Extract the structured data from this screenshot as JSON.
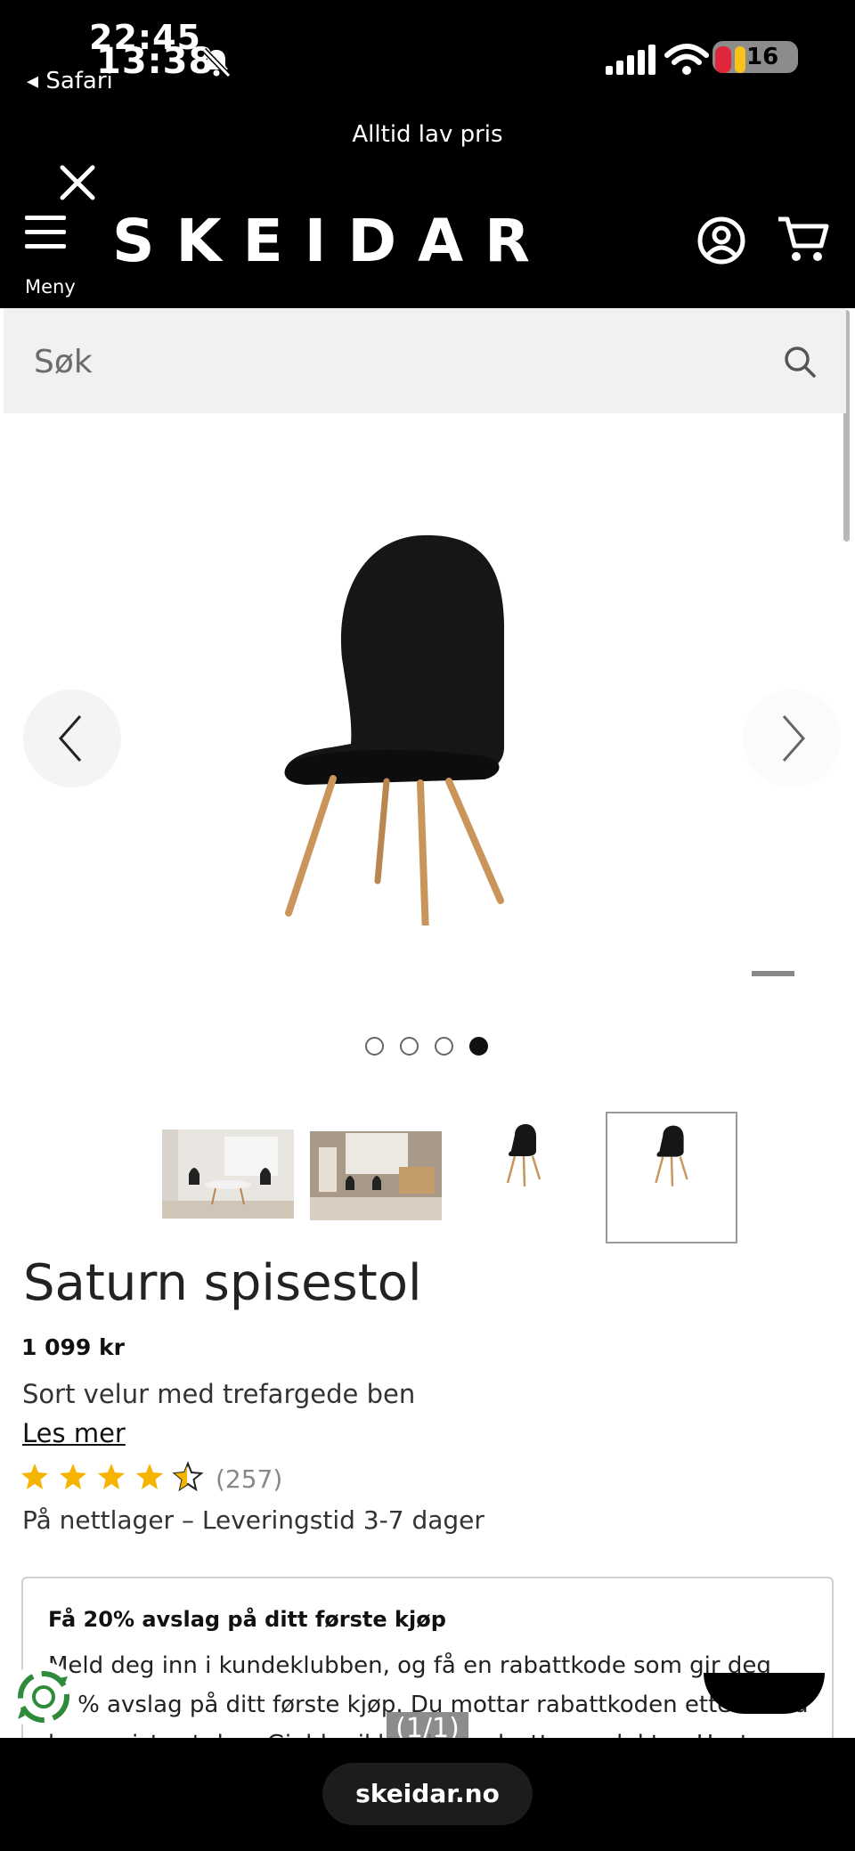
{
  "status_bar": {
    "time_back": "22:45",
    "time_front": "13:38",
    "back_app": "◂ Safari",
    "battery": "16",
    "silent_icon": "bell-slash-icon",
    "signal_icon": "signal-bars-icon",
    "wifi_icon": "wifi-icon"
  },
  "header": {
    "promo": "Alltid lav pris",
    "menu_label": "Meny",
    "logo": "SKEIDAR",
    "close_icon": "close-icon",
    "account_icon": "account-icon",
    "cart_icon": "cart-icon"
  },
  "search": {
    "placeholder": "Søk"
  },
  "gallery": {
    "dots_total": 4,
    "active_dot": 4,
    "counter": "(1/1)"
  },
  "product": {
    "title": "Saturn spisestol",
    "price": "1 099 kr",
    "subtitle": "Sort velur med trefargede ben",
    "read_more": "Les mer",
    "rating": 4.5,
    "rating_count": "(257)",
    "stock": "På nettlager – Leveringstid 3-7 dager"
  },
  "club": {
    "title": "Få 20% avslag på ditt første kjøp",
    "text": "Meld deg inn i kundeklubben, og få en rabattkode som gir deg 20% avslag på ditt første kjøp. Du mottar rabattkoden etter at du har registrert deg. Gjelder ikke alle nedsatte produkter. Høstens"
  },
  "colors": {
    "star": "#f5b400",
    "header_bg": "#000000",
    "chair_leg": "#c9955a",
    "recycle_green": "#2e8b3a"
  },
  "safari": {
    "url": "skeidar.no"
  }
}
